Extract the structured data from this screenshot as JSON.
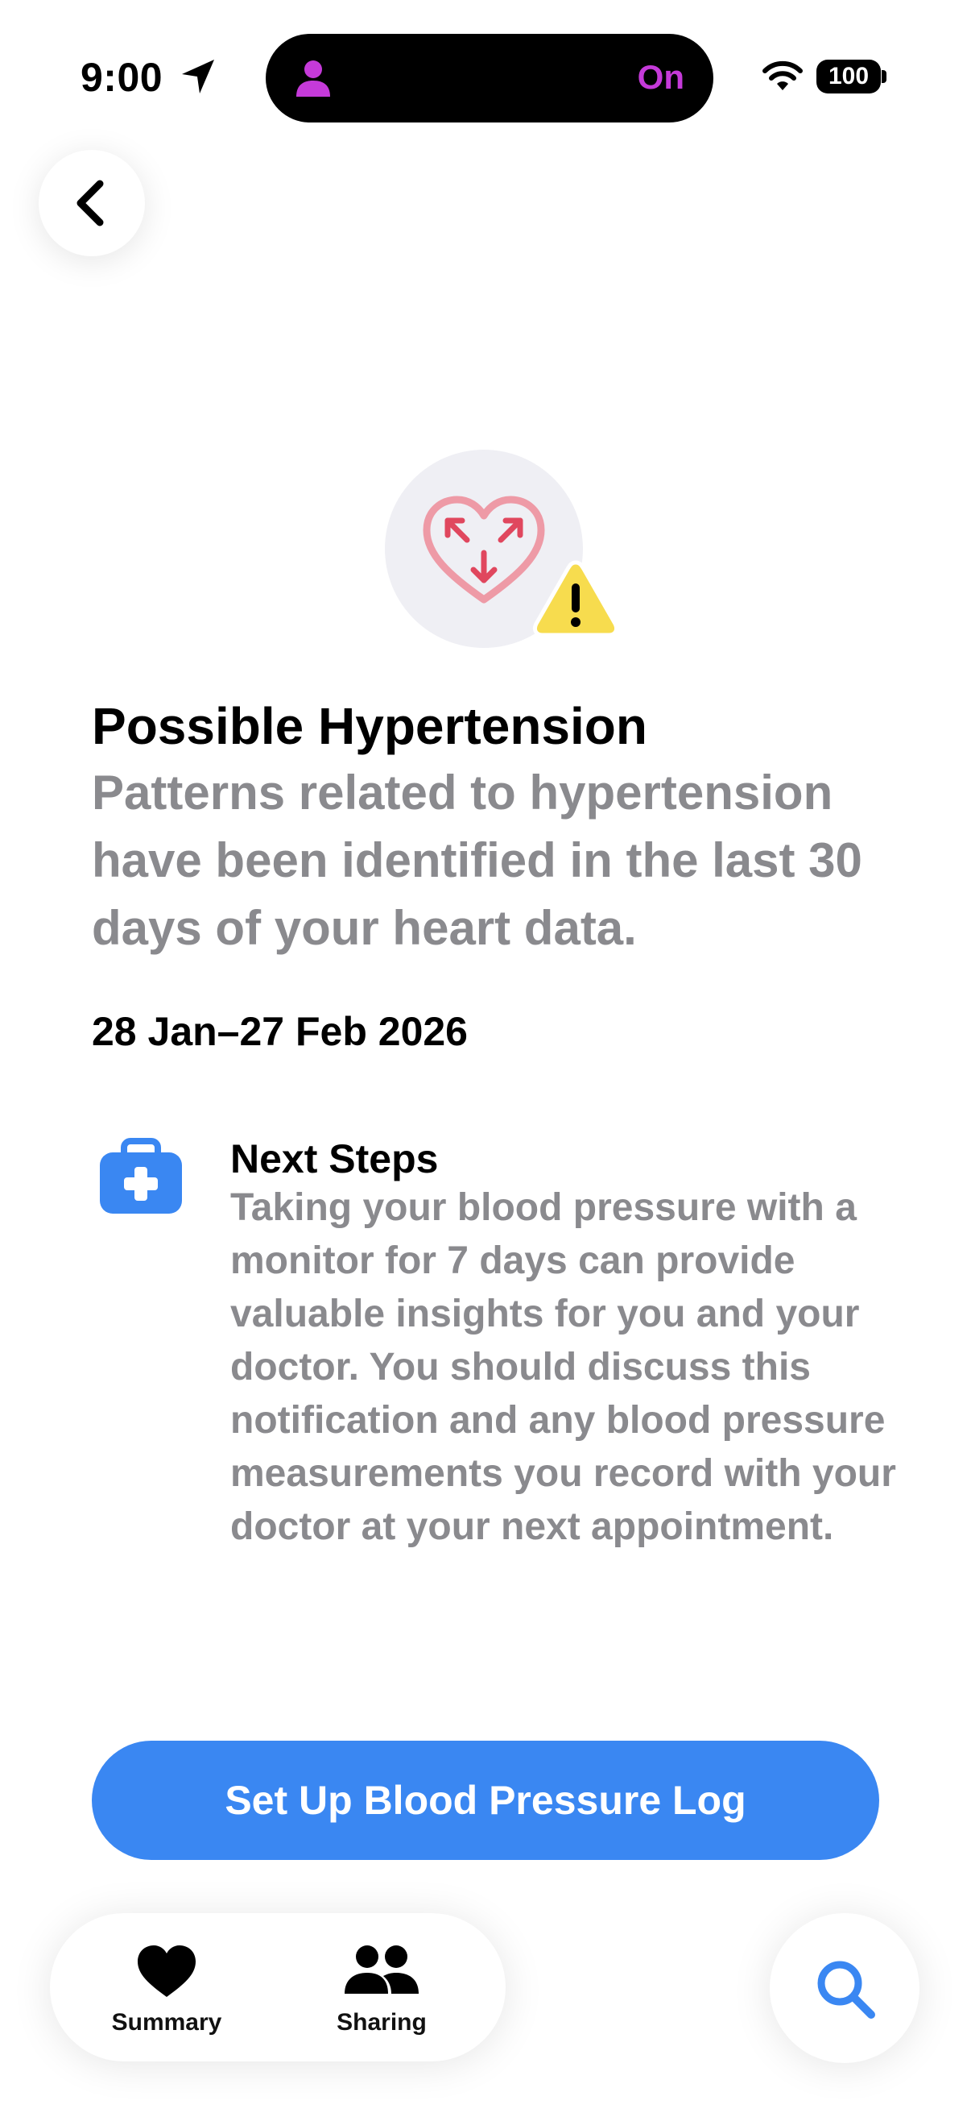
{
  "status_bar": {
    "time": "9:00",
    "island_status": "On",
    "battery_level": "100",
    "icons": [
      "location-arrow-icon",
      "person-icon",
      "wifi-icon",
      "battery-icon"
    ],
    "island_accent": "#c53ad9"
  },
  "navigation": {
    "back_icon": "chevron-left-icon"
  },
  "hero": {
    "icon": "heart-arrows-icon",
    "badge_icon": "warning-triangle-icon",
    "heart_color": "#e0475e",
    "badge_color": "#f7dc4e"
  },
  "content": {
    "title": "Possible Hypertension",
    "subtitle": "Patterns related to hypertension have been identified in the last 30 days of your heart data.",
    "date_range": "28 Jan–27 Feb 2026"
  },
  "next_steps": {
    "icon": "medical-bag-icon",
    "title": "Next Steps",
    "body": "Taking your blood pressure with a monitor for 7 days can provide valuable insights for you and your doctor. You should discuss this notification and any blood pressure measurements you record with your doctor at your next appointment."
  },
  "primary_action": {
    "label": "Set Up Blood Pressure Log",
    "color": "#3a87f2"
  },
  "tab_bar": {
    "tabs": [
      {
        "label": "Summary",
        "icon": "heart-icon"
      },
      {
        "label": "Sharing",
        "icon": "people-icon"
      }
    ],
    "search_icon": "search-icon"
  }
}
